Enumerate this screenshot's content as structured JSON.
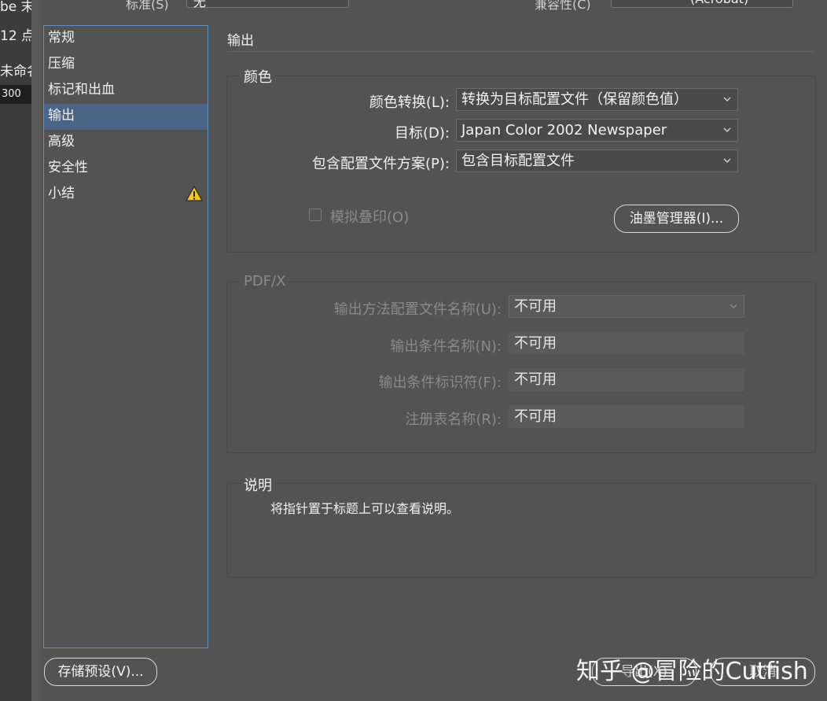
{
  "background_app": {
    "top_text": "be 末",
    "size_text": "12 点",
    "name_text": "未命名",
    "field_value": "300"
  },
  "top_fields": {
    "left_label": "标准(S)",
    "left_value": "无",
    "right_label": "兼容性(C)",
    "right_value": "(Acrobat)"
  },
  "sidebar": {
    "items": [
      {
        "label": "常规"
      },
      {
        "label": "压缩"
      },
      {
        "label": "标记和出血"
      },
      {
        "label": "输出"
      },
      {
        "label": "高级"
      },
      {
        "label": "安全性"
      },
      {
        "label": "小结"
      }
    ],
    "warning_icon": "warning-triangle-icon"
  },
  "panel": {
    "title": "输出",
    "color_group": {
      "label": "颜色",
      "conversion_label": "颜色转换(L):",
      "conversion_value": "转换为目标配置文件（保留颜色值）",
      "target_label": "目标(D):",
      "target_value": "Japan Color 2002 Newspaper",
      "profile_label": "包含配置文件方案(P):",
      "profile_value": "包含目标配置文件",
      "simulate_label": "模拟叠印(O)",
      "ink_manager_label": "油墨管理器(I)..."
    },
    "pdfx_group": {
      "label": "PDF/X",
      "intent_label": "输出方法配置文件名称(U):",
      "intent_value": "不可用",
      "condition_name_label": "输出条件名称(N):",
      "condition_name_value": "不可用",
      "condition_id_label": "输出条件标识符(F):",
      "condition_id_value": "不可用",
      "registry_label": "注册表名称(R):",
      "registry_value": "不可用"
    },
    "description_group": {
      "label": "说明",
      "text": "将指针置于标题上可以查看说明。"
    }
  },
  "footer": {
    "save_preset_label": "存储预设(V)...",
    "export_label": "导出(X)",
    "cancel_label": "取消"
  },
  "watermark": "知乎 @冒险的Cutfish",
  "colors": {
    "dialog_bg": "#535353",
    "selection": "#4a6586",
    "focus_border": "#5d8fc4",
    "warning": "#f5c518"
  }
}
